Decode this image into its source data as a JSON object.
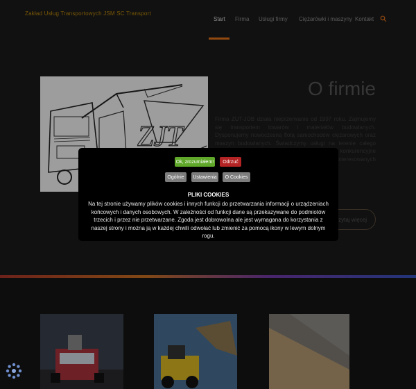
{
  "header": {
    "brand": "Zakład Usług Transportowych JSM SC Transport",
    "nav": [
      "Start",
      "Firma",
      "Usługi firmy",
      "Ciężarówki i maszyny",
      "Kontakt"
    ],
    "active_index": 0
  },
  "about": {
    "title": "O firmie",
    "text": "Firma ZUT-JOB działa nieprzerwanie od 1997 roku. Zajmujemy się transportem towarów i materiałów budowlanych. Dysponujemy nowoczesną flotą samochodów ciężarowych oraz maszyn budowlanych. Świadczymy usługi na terenie całego kraju. Zapewniamy terminowość, rzetelność i konkurencyjne ceny. Zapraszamy do współpracy wszystkich zainteresowanych klientów.",
    "more_label": "Czytaj więcej"
  },
  "cookie": {
    "ok_label": "Ok, zrozumiałem!",
    "decline_label": "Odrzuć",
    "general_label": "Ogólnie",
    "settings_label": "Ustawienia",
    "about_label": "O Cookies",
    "title": "PLIKI COOKIES",
    "text": "Na tej stronie używamy plików cookies i innych funkcji do przetwarzania informacji o urządzeniach końcowych i danych osobowych. W zależności od funkcji dane są przekazywane do podmiotów trzecich i przez nie przetwarzane. Zgoda jest dobrowolna ale jest wymagana do korzystania z naszej strony i można ją w każdej chwili odwołać lub zmienić za pomocą ikony w lewym dolnym rogu."
  },
  "colors": {
    "accent": "#e0701a",
    "brand": "#b8860b",
    "ok": "#5fa829",
    "decline": "#b52424"
  },
  "icons": {
    "search": "search-icon",
    "cookie_settings": "cookie-settings-icon"
  }
}
